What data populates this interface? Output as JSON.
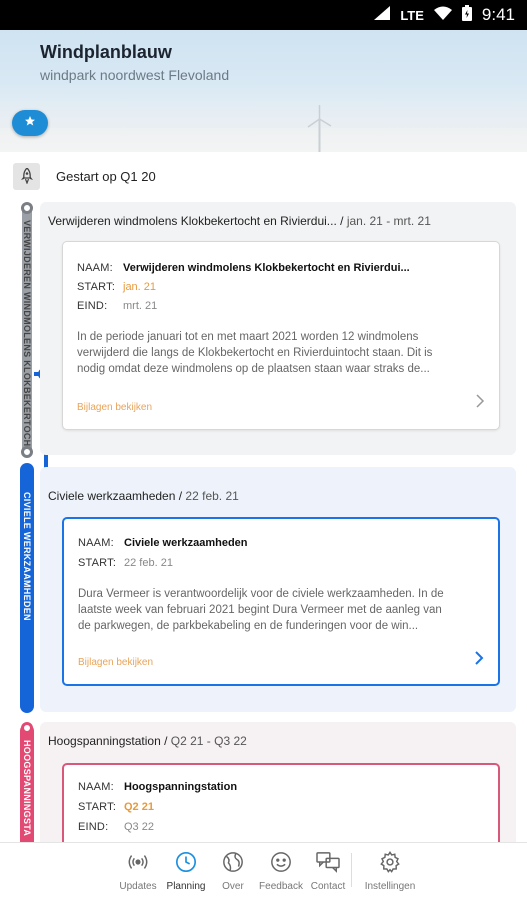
{
  "statusbar": {
    "network": "LTE",
    "time": "9:41"
  },
  "header": {
    "title": "Windplanblauw",
    "subtitle": "windpark noordwest Flevoland",
    "favorite_icon": "star-icon"
  },
  "timeline": {
    "start_label": "Gestart op Q1 20",
    "start_icon": "rocket-icon",
    "colors": {
      "done": "#9aa0a6",
      "current": "#1565d8",
      "upcoming": "#e24a73",
      "attachment": "#e8a45a"
    },
    "phases": [
      {
        "vertical_label": "VERWIJDEREN WINDMOLENS KLOKBEKERTOCHT EN RIVIERDUINTOCHT",
        "title": "Verwijderen windmolens Klokbekertocht en Rivierdui...",
        "range": "jan. 21 - mrt. 21",
        "card": {
          "name_label": "NAAM:",
          "name": "Verwijderen windmolens Klokbekertocht en Rivierdui...",
          "start_label": "START:",
          "start": "jan. 21",
          "end_label": "EIND:",
          "end": "mrt. 21",
          "description": "In de periode januari tot en met maart 2021 worden 12 windmolens verwijderd die langs de Klokbekertocht en Rivierduintocht staan. Dit is nodig omdat deze windmolens op de plaatsen staan waar straks de...",
          "attachments": "Bijlagen bekijken"
        }
      },
      {
        "vertical_label": "CIVIELE WERKZAAMHEDEN",
        "title": "Civiele werkzaamheden",
        "range": "22 feb. 21",
        "card": {
          "name_label": "NAAM:",
          "name": "Civiele werkzaamheden",
          "start_label": "START:",
          "start": "22 feb. 21",
          "description": "Dura Vermeer is verantwoordelijk voor de civiele werkzaamheden. In de laatste week van februari 2021 begint Dura Vermeer met de aanleg van de parkwegen, de parkbekabeling en de funderingen voor de win...",
          "attachments": "Bijlagen bekijken"
        }
      },
      {
        "vertical_label": "HOOGSPANNINGSTA",
        "title": "Hoogspanningstation",
        "range": "Q2 21 - Q3 22",
        "card": {
          "name_label": "NAAM:",
          "name": "Hoogspanningstation",
          "start_label": "START:",
          "start": "Q2 21",
          "end_label": "EIND:",
          "end": "Q3 22"
        }
      }
    ]
  },
  "bottom_nav": {
    "items": [
      {
        "label": "Updates",
        "icon": "broadcast-icon"
      },
      {
        "label": "Planning",
        "icon": "clock-icon"
      },
      {
        "label": "Over",
        "icon": "globe-icon"
      },
      {
        "label": "Feedback",
        "icon": "smiley-icon"
      },
      {
        "label": "Contact",
        "icon": "chat-icon"
      },
      {
        "label": "Instellingen",
        "icon": "gear-icon"
      }
    ]
  }
}
